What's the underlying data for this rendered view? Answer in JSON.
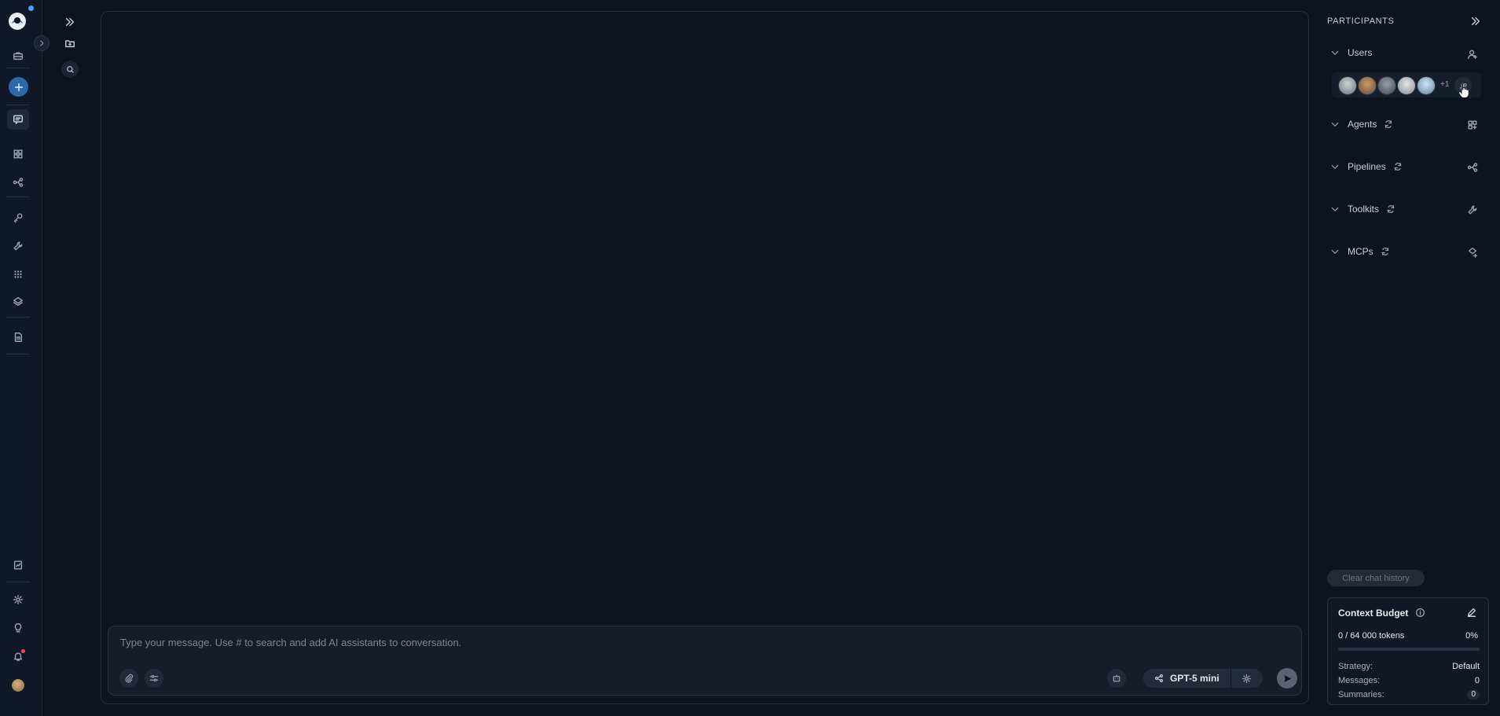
{
  "rail": {
    "items": [
      {
        "name": "briefcase-icon"
      },
      {
        "name": "plus-icon"
      },
      {
        "name": "chat-icon"
      },
      {
        "name": "grid-icon"
      },
      {
        "name": "workflow-icon"
      },
      {
        "name": "key-icon"
      },
      {
        "name": "wrench-icon"
      },
      {
        "name": "apps-icon"
      },
      {
        "name": "layers-icon"
      },
      {
        "name": "document-icon"
      },
      {
        "name": "report-icon"
      },
      {
        "name": "settings-icon"
      },
      {
        "name": "lightbulb-icon"
      },
      {
        "name": "bell-icon"
      }
    ],
    "accent": "#2a6aa8"
  },
  "composer": {
    "placeholder": "Type your message. Use # to search and add AI assistants to conversation.",
    "model": "GPT-5 mini"
  },
  "participants": {
    "title": "PARTICIPANTS",
    "sections": [
      {
        "label": "Users"
      },
      {
        "label": "Agents"
      },
      {
        "label": "Pipelines"
      },
      {
        "label": "Toolkits"
      },
      {
        "label": "MCPs"
      }
    ],
    "users_more": "+1"
  },
  "clear_history_label": "Clear chat history",
  "context_budget": {
    "title": "Context Budget",
    "tokens": "0 / 64 000 tokens",
    "percent": "0%",
    "usage_fraction": 0,
    "rows": [
      {
        "key": "Strategy:",
        "value": "Default"
      },
      {
        "key": "Messages:",
        "value": "0"
      },
      {
        "key": "Summaries:",
        "value": "0"
      }
    ]
  }
}
